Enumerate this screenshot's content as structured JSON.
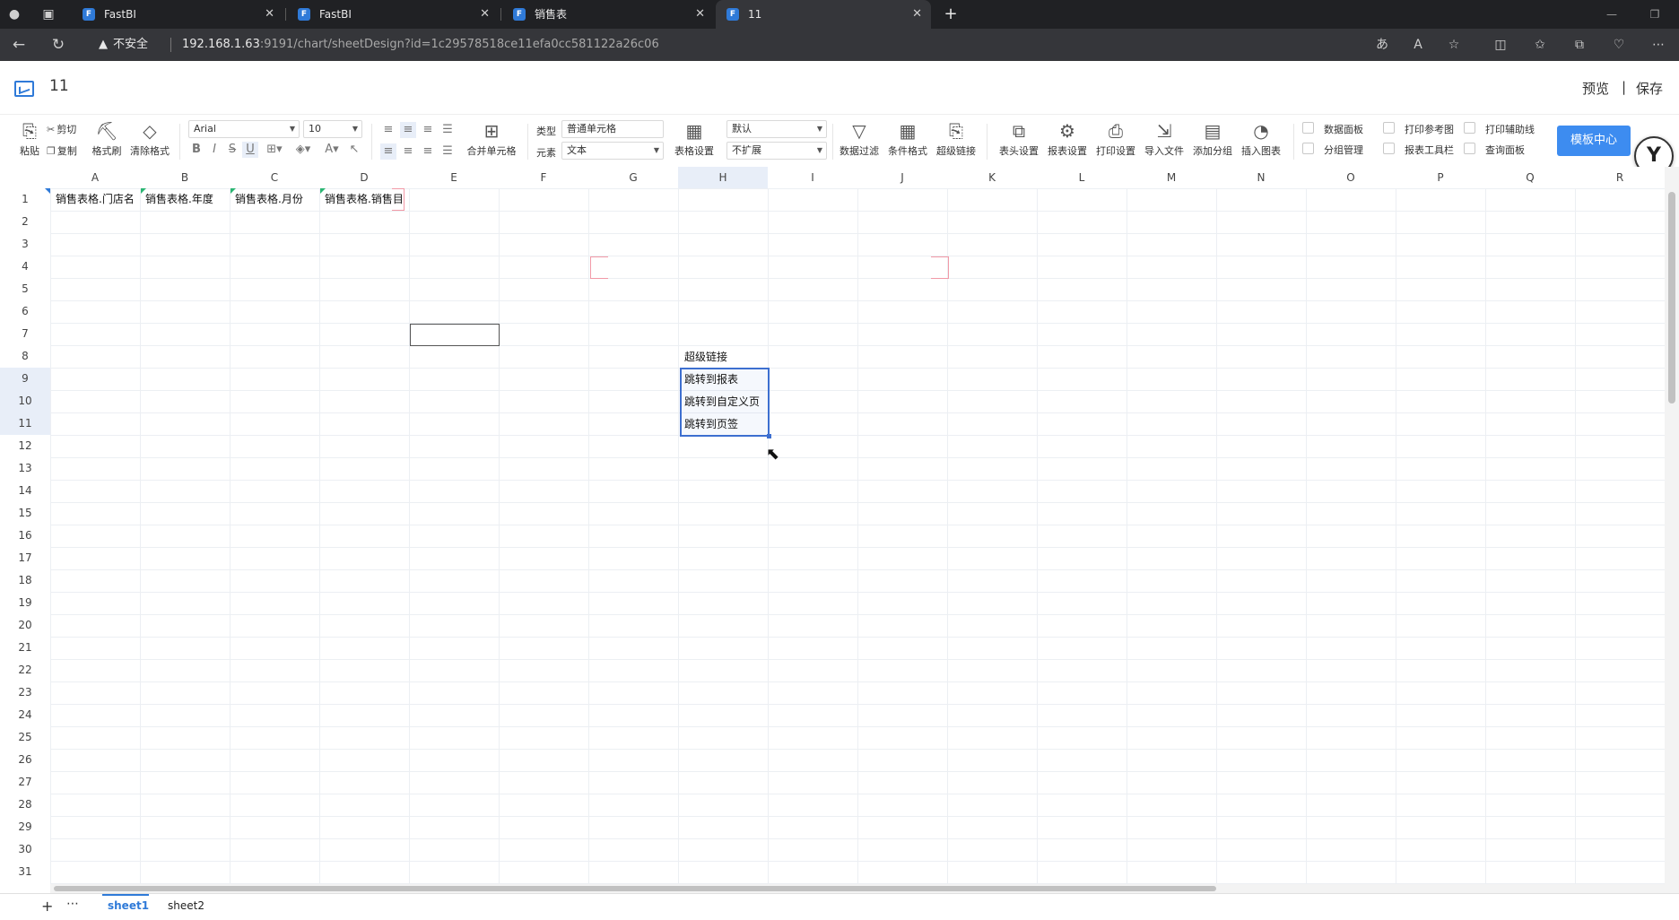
{
  "browser": {
    "tabs": [
      {
        "label": "FastBI",
        "favicon": "fastbi-icon"
      },
      {
        "label": "FastBI",
        "favicon": "fastbi-icon"
      },
      {
        "label": "销售表",
        "favicon": "fastbi-icon"
      },
      {
        "label": "11",
        "favicon": "fastbi-icon",
        "active": true
      }
    ],
    "security_label": "不安全",
    "url_host": "192.168.1.63",
    "url_rest": ":9191/chart/sheetDesign?id=1c29578518ce11efa0cc581122a26c06"
  },
  "app": {
    "title": "11",
    "preview_label": "预览",
    "separator": "|",
    "save_label": "保存",
    "accent_color": "#3d8cf0"
  },
  "toolbar": {
    "paste": "粘贴",
    "cut": "剪切",
    "copy": "复制",
    "format_painter": "格式刷",
    "clear_format": "清除格式",
    "font_family": "Arial",
    "font_size": "10",
    "merge_cells": "合并单元格",
    "type_label": "类型",
    "type_value": "普通单元格",
    "element_label": "元素",
    "element_value": "文本",
    "default_value": "默认",
    "expand_value": "不扩展",
    "table_settings": "表格设置",
    "data_filter": "数据过滤",
    "conditional_format": "条件格式",
    "hyperlink": "超级链接",
    "header_settings": "表头设置",
    "report_settings": "报表设置",
    "print_settings": "打印设置",
    "import_file": "导入文件",
    "add_group": "添加分组",
    "insert_chart": "插入图表",
    "checkboxes": [
      "数据面板",
      "分组管理",
      "打印参考图",
      "报表工具栏",
      "打印辅助线",
      "查询面板"
    ],
    "template_center": "模板中心"
  },
  "sheet": {
    "columns": [
      "A",
      "B",
      "C",
      "D",
      "E",
      "F",
      "G",
      "H",
      "I",
      "J",
      "K",
      "L",
      "M",
      "N",
      "O",
      "P",
      "Q",
      "R"
    ],
    "selected_column": "H",
    "rows": [
      "1",
      "2",
      "3",
      "4",
      "5",
      "6",
      "7",
      "8",
      "9",
      "10",
      "11",
      "12",
      "13",
      "14",
      "15",
      "16",
      "17",
      "18",
      "19",
      "20",
      "21",
      "22",
      "23",
      "24",
      "25",
      "26",
      "27",
      "28",
      "29",
      "30",
      "31"
    ],
    "selected_rows": [
      "9",
      "10",
      "11"
    ],
    "cells": {
      "A1": "销售表格.门店名",
      "B1": "销售表格.年度",
      "C1": "销售表格.月份",
      "D1": "销售表格.销售目",
      "H8": "超级链接",
      "H9": "跳转到报表",
      "H10": "跳转到自定义页",
      "H11": "跳转到页签"
    }
  },
  "sheet_tabs": [
    {
      "label": "sheet1",
      "active": true
    },
    {
      "label": "sheet2",
      "active": false
    }
  ]
}
